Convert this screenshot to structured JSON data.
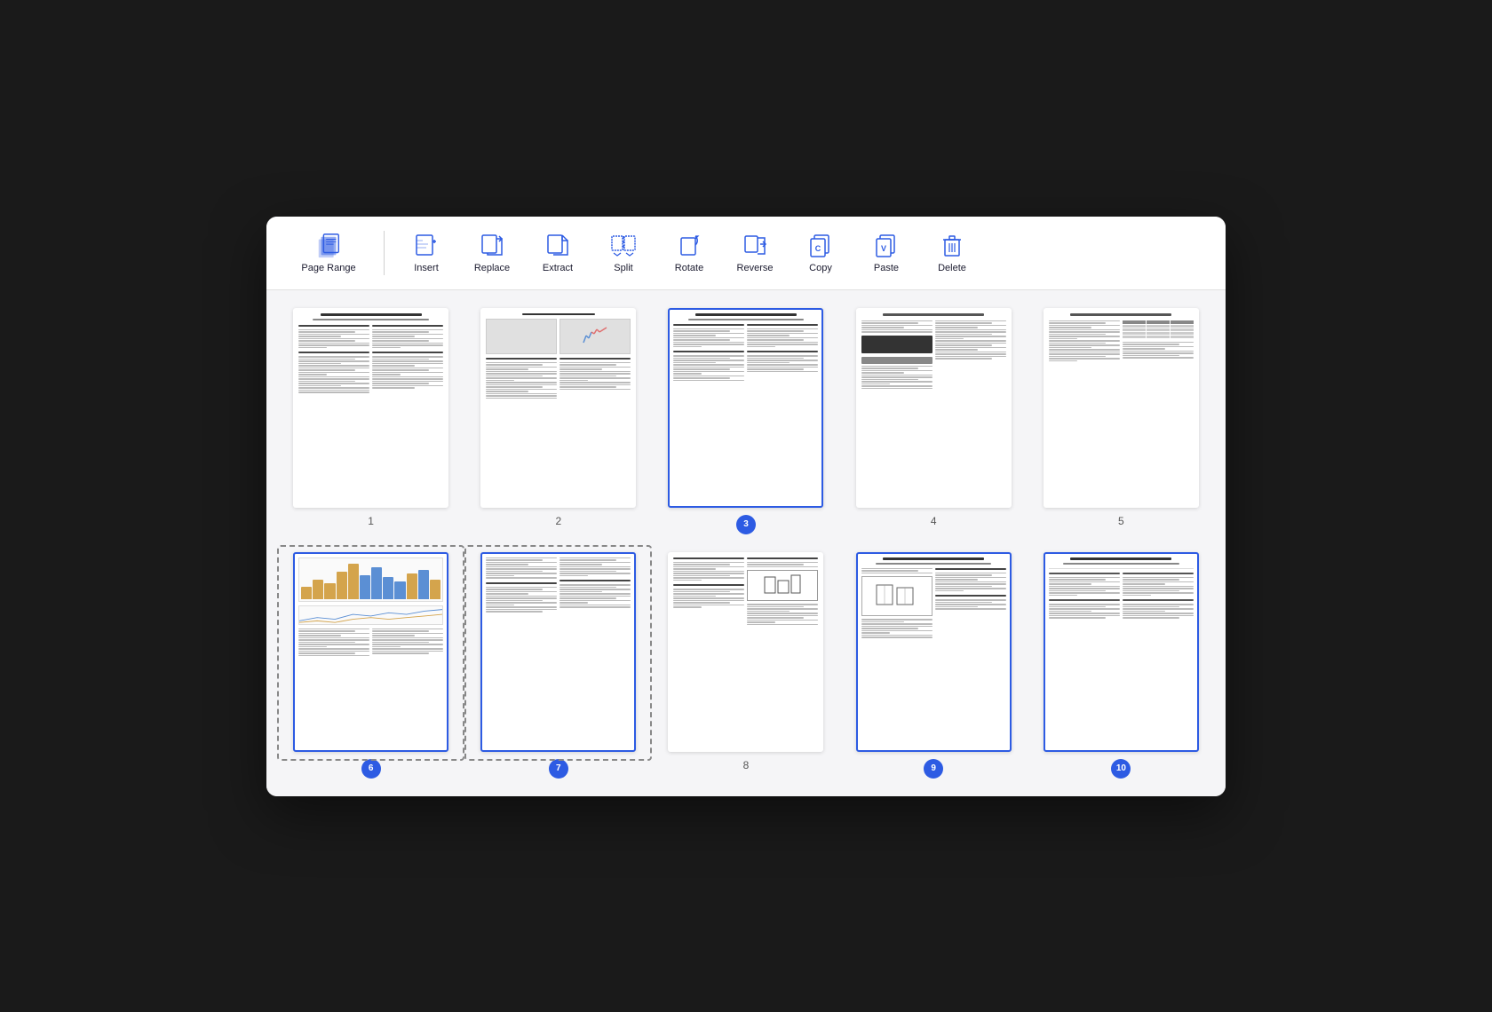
{
  "toolbar": {
    "items": [
      {
        "id": "page-range",
        "label": "Page Range",
        "icon": "page-range-icon"
      },
      {
        "id": "insert",
        "label": "Insert",
        "icon": "insert-icon"
      },
      {
        "id": "replace",
        "label": "Replace",
        "icon": "replace-icon"
      },
      {
        "id": "extract",
        "label": "Extract",
        "icon": "extract-icon"
      },
      {
        "id": "split",
        "label": "Split",
        "icon": "split-icon"
      },
      {
        "id": "rotate",
        "label": "Rotate",
        "icon": "rotate-icon"
      },
      {
        "id": "reverse",
        "label": "Reverse",
        "icon": "reverse-icon"
      },
      {
        "id": "copy",
        "label": "Copy",
        "icon": "copy-icon"
      },
      {
        "id": "paste",
        "label": "Paste",
        "icon": "paste-icon"
      },
      {
        "id": "delete",
        "label": "Delete",
        "icon": "delete-icon"
      }
    ]
  },
  "pages": [
    {
      "num": 1,
      "selected": false,
      "badge": false
    },
    {
      "num": 2,
      "selected": false,
      "badge": false
    },
    {
      "num": 3,
      "selected": true,
      "badge": true
    },
    {
      "num": 4,
      "selected": false,
      "badge": false
    },
    {
      "num": 5,
      "selected": false,
      "badge": false
    },
    {
      "num": 6,
      "selected": true,
      "badge": true,
      "dashed": true
    },
    {
      "num": 7,
      "selected": true,
      "badge": true,
      "dashed": true
    },
    {
      "num": 8,
      "selected": false,
      "badge": false
    },
    {
      "num": 9,
      "selected": true,
      "badge": true
    },
    {
      "num": 10,
      "selected": true,
      "badge": true
    }
  ],
  "accent_color": "#2d5be3"
}
